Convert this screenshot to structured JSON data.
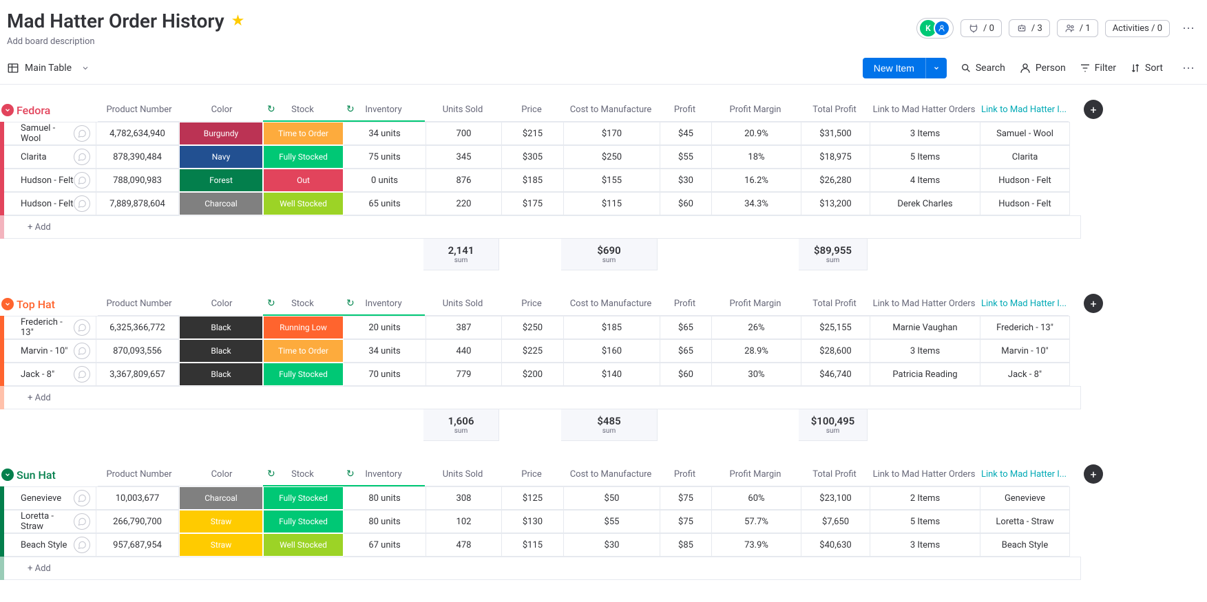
{
  "header": {
    "title": "Mad Hatter Order History",
    "description": "Add board description",
    "stat_eye": "/ 0",
    "stat_robot": "/ 3",
    "stat_people": "/ 1",
    "activities": "Activities / 0",
    "avatar_letter": "K"
  },
  "toolbar": {
    "view_label": "Main Table",
    "new_item": "New Item",
    "search": "Search",
    "person": "Person",
    "filter": "Filter",
    "sort": "Sort"
  },
  "columns": {
    "product_number": "Product Number",
    "color": "Color",
    "stock": "Stock",
    "inventory": "Inventory",
    "units_sold": "Units Sold",
    "price": "Price",
    "cost": "Cost to Manufacture",
    "profit": "Profit",
    "margin": "Profit Margin",
    "total_profit": "Total Profit",
    "link1": "Link to Mad Hatter Orders",
    "link2": "Link to Mad Hatter I...",
    "add_label": "+ Add",
    "sum_label": "sum"
  },
  "groups": [
    {
      "name": "Fedora",
      "color": "#e2445c",
      "rows": [
        {
          "name": "Samuel - Wool",
          "product": "4,782,634,940",
          "color": "Burgundy",
          "color_bg": "#bb3354",
          "stock": "Time to Order",
          "stock_bg": "#fdab3d",
          "inventory": "34 units",
          "units": "700",
          "price": "$215",
          "cost": "$170",
          "profit": "$45",
          "margin": "20.9%",
          "tprofit": "$31,500",
          "link1": "3 Items",
          "link2": "Samuel - Wool"
        },
        {
          "name": "Clarita",
          "product": "878,390,484",
          "color": "Navy",
          "color_bg": "#225091",
          "stock": "Fully Stocked",
          "stock_bg": "#00c875",
          "inventory": "75 units",
          "units": "345",
          "price": "$305",
          "cost": "$250",
          "profit": "$55",
          "margin": "18%",
          "tprofit": "$18,975",
          "link1": "5 Items",
          "link2": "Clarita"
        },
        {
          "name": "Hudson - Felt",
          "product": "788,090,983",
          "color": "Forest",
          "color_bg": "#037f4c",
          "stock": "Out",
          "stock_bg": "#e2445c",
          "inventory": "0 units",
          "units": "876",
          "price": "$185",
          "cost": "$155",
          "profit": "$30",
          "margin": "16.2%",
          "tprofit": "$26,280",
          "link1": "4 Items",
          "link2": "Hudson - Felt"
        },
        {
          "name": "Hudson - Felt",
          "product": "7,889,878,604",
          "color": "Charcoal",
          "color_bg": "#808080",
          "stock": "Well Stocked",
          "stock_bg": "#9cd326",
          "inventory": "65 units",
          "units": "220",
          "price": "$175",
          "cost": "$115",
          "profit": "$60",
          "margin": "34.3%",
          "tprofit": "$13,200",
          "link1": "Derek Charles",
          "link2": "Hudson - Felt"
        }
      ],
      "summary": {
        "units": "2,141",
        "cost": "$690",
        "tprofit": "$89,955"
      }
    },
    {
      "name": "Top Hat",
      "color": "#ff642e",
      "rows": [
        {
          "name": "Frederich - 13\"",
          "product": "6,325,366,772",
          "color": "Black",
          "color_bg": "#333333",
          "stock": "Running Low",
          "stock_bg": "#ff642e",
          "inventory": "20 units",
          "units": "387",
          "price": "$250",
          "cost": "$185",
          "profit": "$65",
          "margin": "26%",
          "tprofit": "$25,155",
          "link1": "Marnie Vaughan",
          "link2": "Frederich - 13\""
        },
        {
          "name": "Marvin - 10\"",
          "product": "870,093,556",
          "color": "Black",
          "color_bg": "#333333",
          "stock": "Time to Order",
          "stock_bg": "#fdab3d",
          "inventory": "34 units",
          "units": "440",
          "price": "$225",
          "cost": "$160",
          "profit": "$65",
          "margin": "28.9%",
          "tprofit": "$28,600",
          "link1": "3 Items",
          "link2": "Marvin - 10\""
        },
        {
          "name": "Jack - 8\"",
          "product": "3,367,809,657",
          "color": "Black",
          "color_bg": "#333333",
          "stock": "Fully Stocked",
          "stock_bg": "#00c875",
          "inventory": "70 units",
          "units": "779",
          "price": "$200",
          "cost": "$140",
          "profit": "$60",
          "margin": "30%",
          "tprofit": "$46,740",
          "link1": "Patricia Reading",
          "link2": "Jack - 8\""
        }
      ],
      "summary": {
        "units": "1,606",
        "cost": "$485",
        "tprofit": "$100,495"
      }
    },
    {
      "name": "Sun Hat",
      "color": "#037f4c",
      "rows": [
        {
          "name": "Genevieve",
          "product": "10,003,677",
          "color": "Charcoal",
          "color_bg": "#808080",
          "stock": "Fully Stocked",
          "stock_bg": "#00c875",
          "inventory": "80 units",
          "units": "308",
          "price": "$125",
          "cost": "$50",
          "profit": "$75",
          "margin": "60%",
          "tprofit": "$23,100",
          "link1": "2 Items",
          "link2": "Genevieve"
        },
        {
          "name": "Loretta - Straw",
          "product": "266,790,700",
          "color": "Straw",
          "color_bg": "#ffcb00",
          "stock": "Fully Stocked",
          "stock_bg": "#00c875",
          "inventory": "80 units",
          "units": "102",
          "price": "$130",
          "cost": "$55",
          "profit": "$75",
          "margin": "57.7%",
          "tprofit": "$7,650",
          "link1": "5 Items",
          "link2": "Loretta - Straw"
        },
        {
          "name": "Beach Style",
          "product": "957,687,954",
          "color": "Straw",
          "color_bg": "#ffcb00",
          "stock": "Well Stocked",
          "stock_bg": "#9cd326",
          "inventory": "67 units",
          "units": "478",
          "price": "$115",
          "cost": "$30",
          "profit": "$85",
          "margin": "73.9%",
          "tprofit": "$40,630",
          "link1": "3 Items",
          "link2": "Beach Style"
        }
      ],
      "summary": null
    }
  ]
}
